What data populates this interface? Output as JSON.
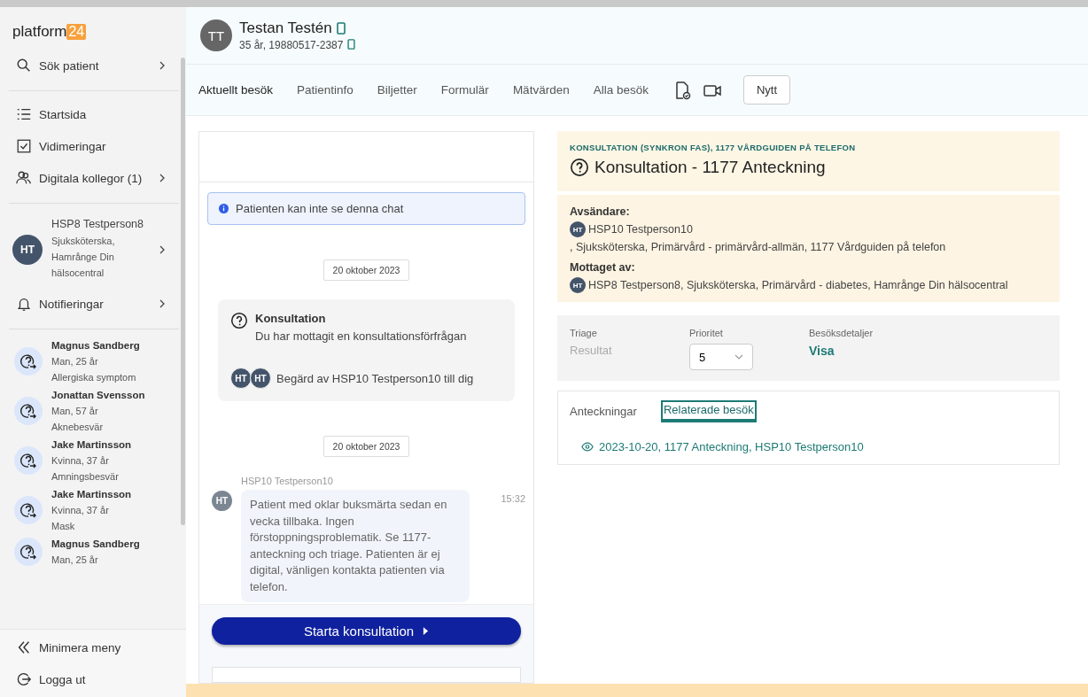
{
  "sidebar": {
    "logo": {
      "text": "platform",
      "badge": "24"
    },
    "search": {
      "label": "Sök patient"
    },
    "nav": [
      {
        "label": "Startsida",
        "kind": "list",
        "submenu": false
      },
      {
        "label": "Vidimeringar",
        "kind": "checkbox",
        "submenu": false
      },
      {
        "label": "Digitala kollegor (1)",
        "kind": "people",
        "submenu": true
      }
    ],
    "user": {
      "initials": "HT",
      "name": "HSP8 Testperson8",
      "info": "Sjuksköterska, Hamrånge Din hälsocentral"
    },
    "notifications": {
      "label": "Notifieringar"
    },
    "queue": [
      {
        "name": "Magnus Sandberg",
        "details": "Man, 25 år",
        "reason": "Allergiska symptom"
      },
      {
        "name": "Jonattan Svensson",
        "details": "Man, 57 år",
        "reason": "Aknebesvär"
      },
      {
        "name": "Jake Martinsson",
        "details": "Kvinna, 37 år",
        "reason": "Amningsbesvär"
      },
      {
        "name": "Jake Martinsson",
        "details": "Kvinna, 37 år",
        "reason": "Mask"
      },
      {
        "name": "Magnus Sandberg",
        "details": "Man, 25 år"
      }
    ],
    "footer": [
      {
        "label": "Minimera meny",
        "kind": "collapse"
      },
      {
        "label": "Logga ut",
        "kind": "logout"
      }
    ]
  },
  "patient": {
    "initials": "TT",
    "name": "Testan Testén",
    "details": "35 år, 19880517-2387"
  },
  "tabs": [
    {
      "label": "Aktuellt besök",
      "selected": true
    },
    {
      "label": "Patientinfo",
      "selected": false
    },
    {
      "label": "Biljetter",
      "selected": false
    },
    {
      "label": "Formulär",
      "selected": false
    },
    {
      "label": "Mätvärden",
      "selected": false
    },
    {
      "label": "Alla besök",
      "selected": false
    }
  ],
  "new_button": "Nytt",
  "chat": {
    "notice": "Patienten kan inte se denna chat",
    "events": [
      {
        "kind": "date",
        "text": "20 oktober 2023"
      },
      {
        "kind": "consultation",
        "title": "Konsultation",
        "text": "Du har mottagit en konsultationsförfrågan",
        "avatars": [
          "HT",
          "HT"
        ],
        "requested": "Begärd av HSP10 Testperson10 till dig"
      },
      {
        "kind": "date",
        "text": "20 oktober 2023"
      },
      {
        "kind": "message",
        "sender": "HSP10 Testperson10",
        "initials": "HT",
        "text": "Patient med oklar buksmärta sedan en vecka tillbaka. Ingen förstoppningsproblematik. Se 1177-anteckning och triage. Patienten är ej digital, vänligen kontakta patienten via telefon.",
        "time": "15:32"
      }
    ],
    "start_button": "Starta konsultation"
  },
  "details": {
    "category": "KONSULTATION (SYNKRON FAS), 1177 VÅRDGUIDEN PÅ TELEFON",
    "title": "Konsultation - 1177 Anteckning",
    "sender_label": "Avsändare:",
    "sender": {
      "initials": "HT",
      "name": "HSP10 Testperson10",
      "info": ", Sjuksköterska, Primärvård - primärvård-allmän, 1177 Vårdguiden på telefon"
    },
    "receiver_label": "Mottaget av:",
    "receiver": {
      "initials": "HT",
      "info": "HSP8 Testperson8, Sjuksköterska, Primärvård - diabetes, Hamrånge Din hälsocentral"
    }
  },
  "triage": [
    {
      "label": "Triage",
      "value": "Resultat",
      "kind": "muted"
    },
    {
      "label": "Prioritet",
      "value": "5",
      "kind": "select"
    },
    {
      "label": "Besöksdetaljer",
      "value": "Visa",
      "kind": "link"
    }
  ],
  "related": {
    "tabs": [
      {
        "label": "Anteckningar",
        "selected": false
      },
      {
        "label": "Relaterade besök",
        "selected": true
      }
    ],
    "items": [
      {
        "text": "2023-10-20, 1177 Anteckning, HSP10 Testperson10"
      }
    ]
  }
}
